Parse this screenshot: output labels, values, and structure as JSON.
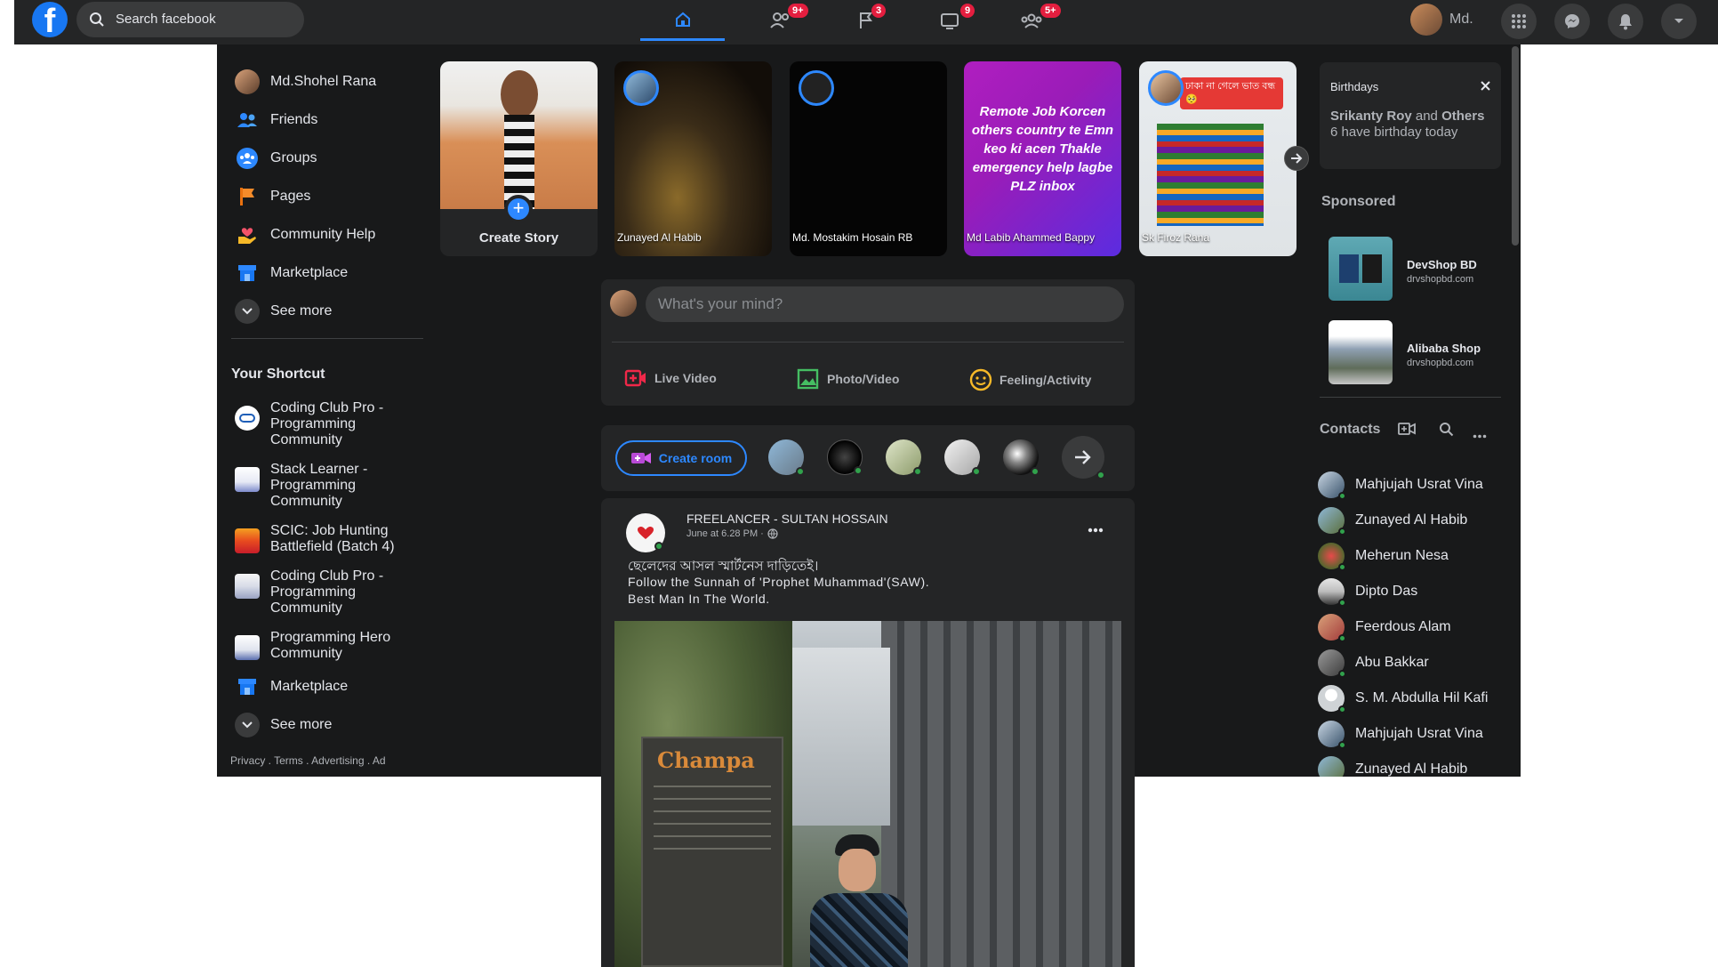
{
  "topbar": {
    "search_placeholder": "Search facebook",
    "badges": {
      "friends": "9+",
      "pages": "3",
      "watch": "9",
      "groups": "5+"
    },
    "profile_short": "Md."
  },
  "left_nav": {
    "items": [
      {
        "label": "Md.Shohel Rana",
        "icon": "profile-avatar"
      },
      {
        "label": "Friends",
        "icon": "friends-icon"
      },
      {
        "label": "Groups",
        "icon": "groups-icon"
      },
      {
        "label": "Pages",
        "icon": "flag-icon"
      },
      {
        "label": "Community Help",
        "icon": "heart-hand-icon"
      },
      {
        "label": "Marketplace",
        "icon": "shop-icon"
      },
      {
        "label": "See more",
        "icon": "chevron-down-icon"
      }
    ],
    "shortcut_title": "Your Shortcut",
    "shortcuts": [
      {
        "label": "Coding Club Pro - Programming Community"
      },
      {
        "label": "Stack Learner - Programming Community"
      },
      {
        "label": "SCIC: Job Hunting Battlefield (Batch 4)"
      },
      {
        "label": "Coding Club Pro - Programming Community"
      },
      {
        "label": "Programming Hero Community"
      }
    ],
    "marketplace_label": "Marketplace",
    "see_more_label": "See more",
    "footer": "Privacy . Terms . Advertising . Ad"
  },
  "stories": {
    "create_label": "Create Story",
    "items": [
      {
        "name": "Zunayed Al Habib"
      },
      {
        "name": "Md. Mostakim Hosain RB"
      },
      {
        "name": "Md Labib Ahammed Bappy",
        "text": "Remote Job Korcen others country te Emn keo ki acen Thakle emergency help lagbe PLZ inbox"
      },
      {
        "name": "Sk Firoz Rana",
        "caption": "ঢাকা না গেলে ভাত বন্ধ 🥺"
      }
    ]
  },
  "composer": {
    "placeholder": "What's your mind?",
    "live_video": "Live Video",
    "photo_video": "Photo/Video",
    "feeling": "Feeling/Activity"
  },
  "rooms": {
    "create_label": "Create room"
  },
  "post": {
    "author": "FREELANCER - SULTAN HOSSAIN",
    "time": "June at 6.28 PM ·",
    "text_line1": "ছেলেদের আসল স্মার্টনেস দাড়িতেই।",
    "text_line2": "Follow the Sunnah of 'Prophet Muhammad'(SAW).",
    "text_line3": "Best Man In The World.",
    "image_sign": "Champa"
  },
  "right": {
    "birthdays_title": "Birthdays",
    "birthday_name": "Srikanty Roy",
    "birthday_and": " and ",
    "birthday_others": "Others",
    "birthday_rest": " 6 have birthday today",
    "sponsored_title": "Sponsored",
    "ads": [
      {
        "name": "DevShop BD",
        "url": "drvshopbd.com"
      },
      {
        "name": "Alibaba Shop",
        "url": "drvshopbd.com"
      }
    ],
    "contacts_title": "Contacts",
    "contacts": [
      {
        "name": "Mahjujah Usrat Vina"
      },
      {
        "name": "Zunayed Al Habib"
      },
      {
        "name": "Meherun Nesa"
      },
      {
        "name": "Dipto Das"
      },
      {
        "name": "Feerdous Alam"
      },
      {
        "name": "Abu Bakkar"
      },
      {
        "name": "S. M. Abdulla Hil Kafi"
      },
      {
        "name": "Mahjujah Usrat Vina"
      },
      {
        "name": "Zunayed Al Habib"
      }
    ]
  },
  "colors": {
    "accent": "#2d88ff",
    "badge": "#e41e3f",
    "online": "#31a24c",
    "panel": "#242526",
    "background": "#18191a"
  }
}
